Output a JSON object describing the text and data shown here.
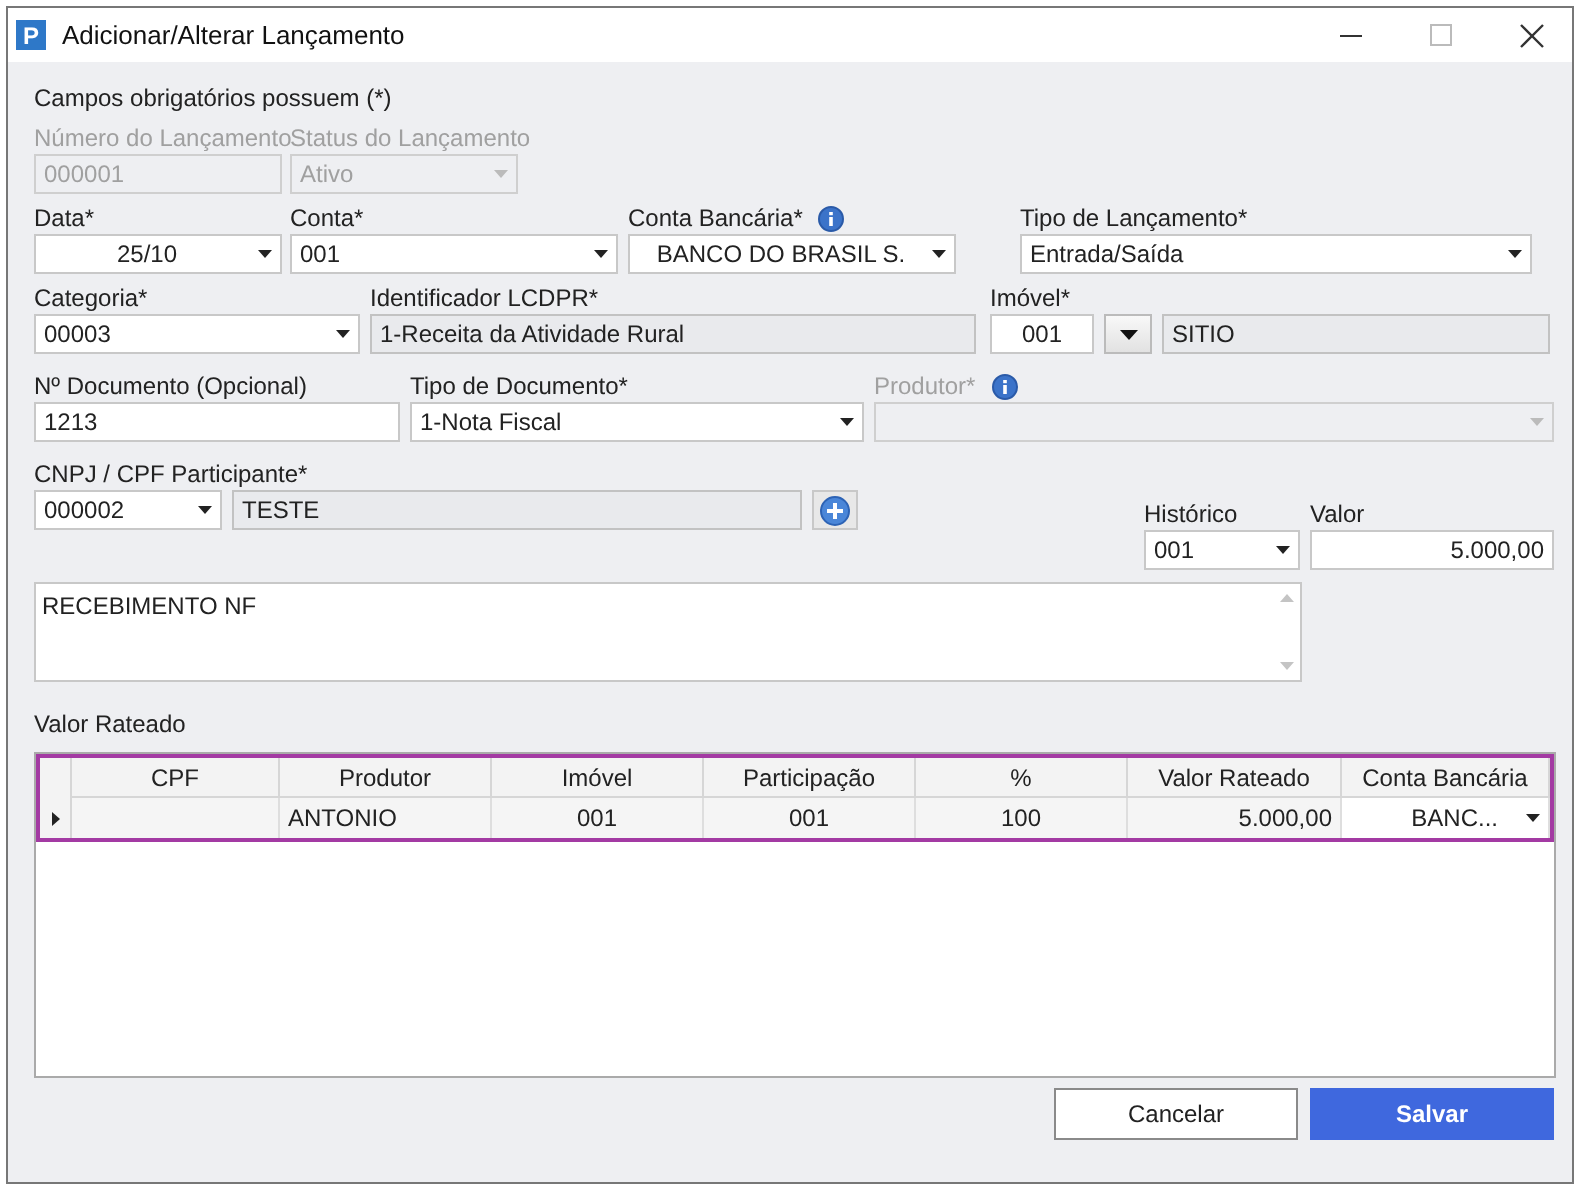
{
  "window": {
    "icon_text": "P",
    "title": "Adicionar/Alterar Lançamento"
  },
  "required_note": "Campos obrigatórios possuem (*)",
  "rows": [
    [
      {
        "kind": "text",
        "label": "Número do Lançamento",
        "value": "000001",
        "disabled": true,
        "readonly": false,
        "info": false
      },
      {
        "kind": "combo",
        "label": "Status do Lançamento",
        "value": "Ativo",
        "disabled": true,
        "readonly": false,
        "info": false
      }
    ],
    [
      {
        "kind": "combo",
        "label": "Data*",
        "value": "25/10",
        "disabled": false,
        "readonly": false,
        "info": false
      },
      {
        "kind": "combo",
        "label": "Conta*",
        "value": "001",
        "disabled": false,
        "readonly": false,
        "info": false
      },
      {
        "kind": "combo",
        "label": "Conta Bancária*",
        "value": "BANCO DO BRASIL S.",
        "disabled": false,
        "readonly": false,
        "info": true
      },
      {
        "kind": "combo",
        "label": "Tipo de Lançamento*",
        "value": "Entrada/Saída",
        "disabled": false,
        "readonly": false,
        "info": false
      }
    ],
    [
      {
        "kind": "combo",
        "label": "Categoria*",
        "value": "00003",
        "disabled": false,
        "readonly": false,
        "info": false
      },
      {
        "kind": "text",
        "label": "Identificador LCDPR*",
        "value": "1-Receita da Atividade Rural",
        "disabled": false,
        "readonly": true,
        "info": false
      },
      {
        "kind": "lookup",
        "label": "Imóvel*",
        "code": "001",
        "name": "SITIO",
        "disabled": false,
        "readonly": false,
        "info": false
      }
    ],
    [
      {
        "kind": "text",
        "label": "Nº Documento (Opcional)",
        "value": "1213",
        "disabled": false,
        "readonly": false,
        "info": false
      },
      {
        "kind": "combo",
        "label": "Tipo de Documento*",
        "value": "1-Nota Fiscal",
        "disabled": false,
        "readonly": false,
        "info": false
      },
      {
        "kind": "combo",
        "label": "Produtor*",
        "disabled": true,
        "readonly": false,
        "info": true
      }
    ]
  ],
  "participant": {
    "label": "CNPJ / CPF Participante*",
    "code": "000002",
    "name": "TESTE"
  },
  "historico": {
    "label": "Histórico",
    "value": "001"
  },
  "valor": {
    "label": "Valor",
    "value": "5.000,00"
  },
  "memo": {
    "value": "RECEBIMENTO NF"
  },
  "grid": {
    "title": "Valor Rateado",
    "columns": [
      "CPF",
      "Produtor",
      "Imóvel",
      "Participação",
      "%",
      "Valor Rateado",
      "Conta Bancária"
    ],
    "rows": [
      {
        "current": true,
        "cells": [
          null,
          "ANTONIO",
          "001",
          "001",
          "100",
          "5.000,00",
          "BANC..."
        ]
      }
    ]
  },
  "buttons": [
    {
      "kind": "secondary",
      "label": "Cancelar"
    },
    {
      "kind": "primary",
      "label": "Salvar"
    }
  ]
}
